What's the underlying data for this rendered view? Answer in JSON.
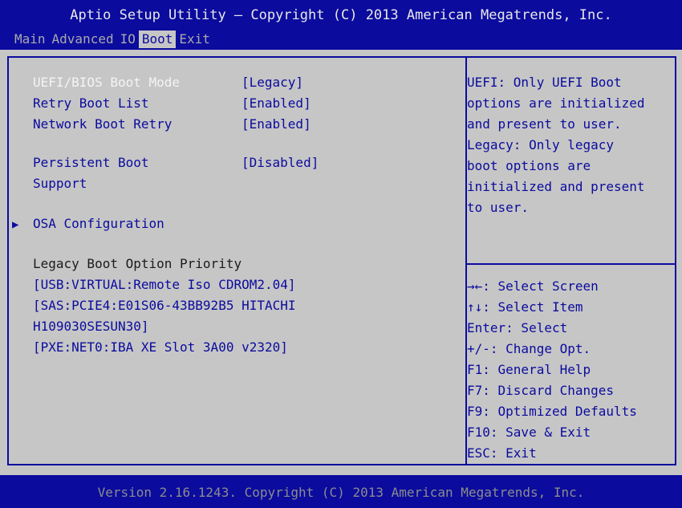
{
  "header": {
    "title": "Aptio Setup Utility – Copyright (C) 2013 American Megatrends, Inc.",
    "menu": [
      {
        "label": "Main"
      },
      {
        "label": "Advanced"
      },
      {
        "label": "IO"
      },
      {
        "label": "Boot"
      },
      {
        "label": "Exit"
      }
    ],
    "active_menu": "Boot"
  },
  "settings": [
    {
      "label": "UEFI/BIOS Boot Mode",
      "value": "[Legacy]"
    },
    {
      "label": "Retry Boot List",
      "value": "[Enabled]"
    },
    {
      "label": "Network Boot Retry",
      "value": "[Enabled]"
    },
    {
      "label": "Persistent Boot",
      "label2": "Support",
      "value": "[Disabled]"
    }
  ],
  "submenu": {
    "label": "OSA Configuration"
  },
  "boot_priority": {
    "heading": "Legacy Boot Option Priority",
    "items": [
      "[USB:VIRTUAL:Remote Iso CDROM2.04]",
      "[SAS:PCIE4:E01S06-43BB92B5 HITACHI",
      "H109030SESUN30]",
      "[PXE:NET0:IBA XE Slot 3A00 v2320]"
    ]
  },
  "help": {
    "lines": [
      "UEFI: Only UEFI Boot",
      "options are initialized",
      "and present to user.",
      "Legacy: Only legacy",
      "boot options are",
      "initialized and present",
      "to user."
    ]
  },
  "keys": [
    {
      "key": "→←",
      "desc": ": Select Screen"
    },
    {
      "key": "↑↓",
      "desc": ": Select Item"
    },
    {
      "key": "",
      "desc": "Enter: Select"
    },
    {
      "key": "",
      "desc": "+/-: Change Opt."
    },
    {
      "key": "",
      "desc": "F1: General Help"
    },
    {
      "key": "",
      "desc": "F7: Discard Changes"
    },
    {
      "key": "",
      "desc": "F9: Optimized Defaults"
    },
    {
      "key": "",
      "desc": "F10: Save & Exit"
    },
    {
      "key": "",
      "desc": "ESC: Exit"
    }
  ],
  "footer": {
    "version": "Version 2.16.1243. Copyright (C) 2013 American Megatrends, Inc."
  },
  "colors": {
    "blue": "#0b0b9e",
    "gray": "#c6c6c6",
    "white": "#f4f4f4"
  }
}
